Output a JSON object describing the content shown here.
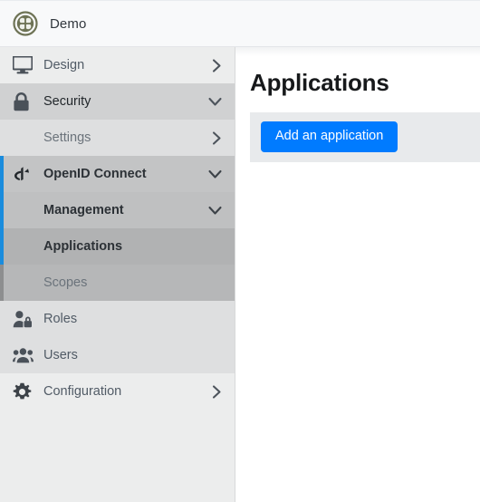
{
  "header": {
    "brand": "Demo",
    "logo_icon": "clover-circle-logo",
    "logo_color": "#6e7355",
    "background": "#f8f9fa"
  },
  "sidebar": {
    "accent_color": "#1a8cdd",
    "accent_inactive_color": "#8d8e8f",
    "items": [
      {
        "label": "Design",
        "icon": "monitor-icon",
        "chevron": "right",
        "level": 0,
        "accent": "none",
        "state": "normal"
      },
      {
        "label": "Security",
        "icon": "lock-icon",
        "chevron": "down",
        "level": 1,
        "accent": "none",
        "state": "dark"
      },
      {
        "label": "Settings",
        "icon": "",
        "chevron": "right",
        "level": 1,
        "accent": "none",
        "state": "muted"
      },
      {
        "label": "OpenID Connect",
        "icon": "openid-icon",
        "chevron": "down",
        "level": 2,
        "accent": "blue",
        "state": "bold"
      },
      {
        "label": "Management",
        "icon": "",
        "chevron": "down",
        "level": 2,
        "accent": "blue",
        "state": "bold"
      },
      {
        "label": "Applications",
        "icon": "",
        "chevron": "none",
        "level": 3,
        "accent": "blue",
        "state": "bold"
      },
      {
        "label": "Scopes",
        "icon": "",
        "chevron": "none",
        "level": 3,
        "accent": "gray",
        "state": "muted"
      },
      {
        "label": "Roles",
        "icon": "person-lock-icon",
        "chevron": "none",
        "level": 1,
        "accent": "none",
        "state": "normal"
      },
      {
        "label": "Users",
        "icon": "people-group-icon",
        "chevron": "none",
        "level": 1,
        "accent": "none",
        "state": "normal"
      },
      {
        "label": "Configuration",
        "icon": "gear-icon",
        "chevron": "right",
        "level": 0,
        "accent": "none",
        "state": "normal"
      }
    ]
  },
  "main": {
    "title": "Applications",
    "add_button_label": "Add an application",
    "add_button_color": "#007bff",
    "panel_background": "#e8eaec"
  }
}
